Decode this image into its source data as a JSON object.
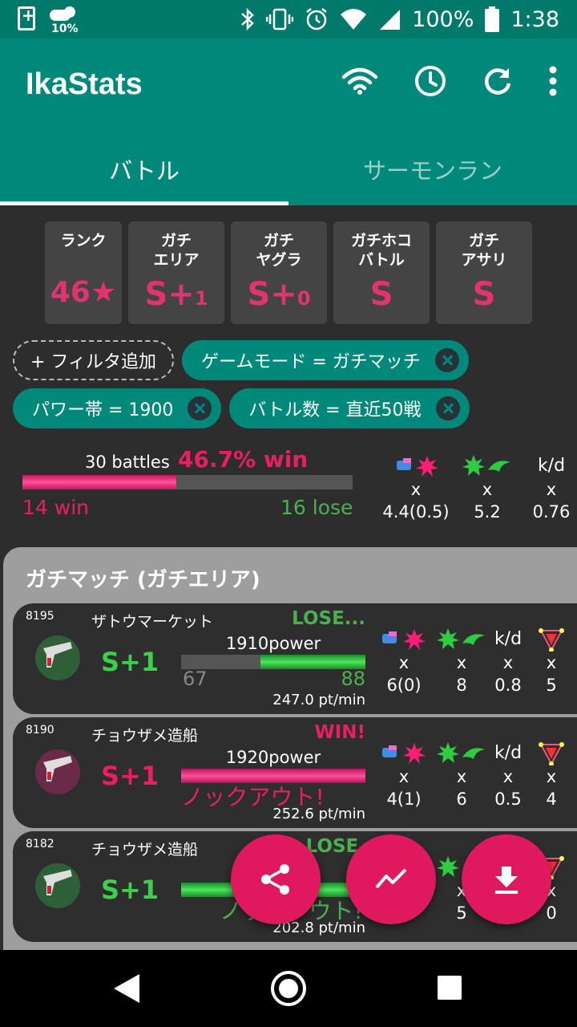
{
  "status_bar": {
    "weather_pct": "10%",
    "battery": "100%",
    "time": "1:38"
  },
  "app": {
    "title": "IkaStats"
  },
  "tabs": [
    {
      "label": "バトル",
      "active": true
    },
    {
      "label": "サーモンラン",
      "active": false
    }
  ],
  "ranks": [
    {
      "label": "ランク",
      "value": "46★",
      "suffix": ""
    },
    {
      "label": "ガチ\nエリア",
      "value": "S+",
      "suffix": "1"
    },
    {
      "label": "ガチ\nヤグラ",
      "value": "S+",
      "suffix": "0"
    },
    {
      "label": "ガチホコ\nバトル",
      "value": "S",
      "suffix": ""
    },
    {
      "label": "ガチ\nアサリ",
      "value": "S",
      "suffix": ""
    }
  ],
  "filters": {
    "add_label": "+ フィルタ追加",
    "chips": [
      "ゲームモード = ガチマッチ",
      "パワー帯 = 1900",
      "バトル数 = 直近50戦"
    ]
  },
  "summary": {
    "battles": "30 battles",
    "win_rate": "46.7% win",
    "win_fraction": 0.467,
    "wins": "14 win",
    "loses": "16 lose",
    "stat_x": "x",
    "kd_label": "k/d",
    "kill_assist": "4.4(0.5)",
    "special": "5.2",
    "kd": "0.76"
  },
  "section": {
    "title": "ガチマッチ (ガチエリア)"
  },
  "battles": [
    {
      "id": "8195",
      "stage": "ザトウマーケット",
      "result": "LOSE...",
      "result_type": "lose",
      "rank": "S+1",
      "power": "1910power",
      "left_score": "67",
      "right_score": "88",
      "ko": "",
      "pt_per_min": "247.0 pt/min",
      "kill_assist": "6(0)",
      "special": "8",
      "kd": "0.8",
      "signal": "5",
      "x": "x"
    },
    {
      "id": "8190",
      "stage": "チョウザメ造船",
      "result": "WIN!",
      "result_type": "win",
      "rank": "S+1",
      "power": "1920power",
      "left_score": "",
      "right_score": "",
      "ko": "ノックアウト!",
      "pt_per_min": "252.6 pt/min",
      "kill_assist": "4(1)",
      "special": "6",
      "kd": "0.5",
      "signal": "4",
      "x": "x"
    },
    {
      "id": "8182",
      "stage": "チョウザメ造船",
      "result": "LOSE.",
      "result_type": "lose",
      "rank": "S+1",
      "power": "",
      "left_score": "",
      "right_score": "",
      "ko": "ノックアウト!",
      "pt_per_min": "202.8 pt/min",
      "kill_assist": "",
      "special": "5",
      "kd": "",
      "signal": "0",
      "x": "x"
    }
  ],
  "icons": {
    "wifi": "wifi-icon",
    "history": "history-icon",
    "refresh": "refresh-icon",
    "more": "more-vert-icon",
    "share": "share-icon",
    "chart": "trend-chart-icon",
    "download": "download-icon"
  },
  "colors": {
    "primary": "#00897b",
    "status": "#00796b",
    "accent": "#e0195f",
    "win": "#e91e63",
    "lose": "#4caf50"
  }
}
